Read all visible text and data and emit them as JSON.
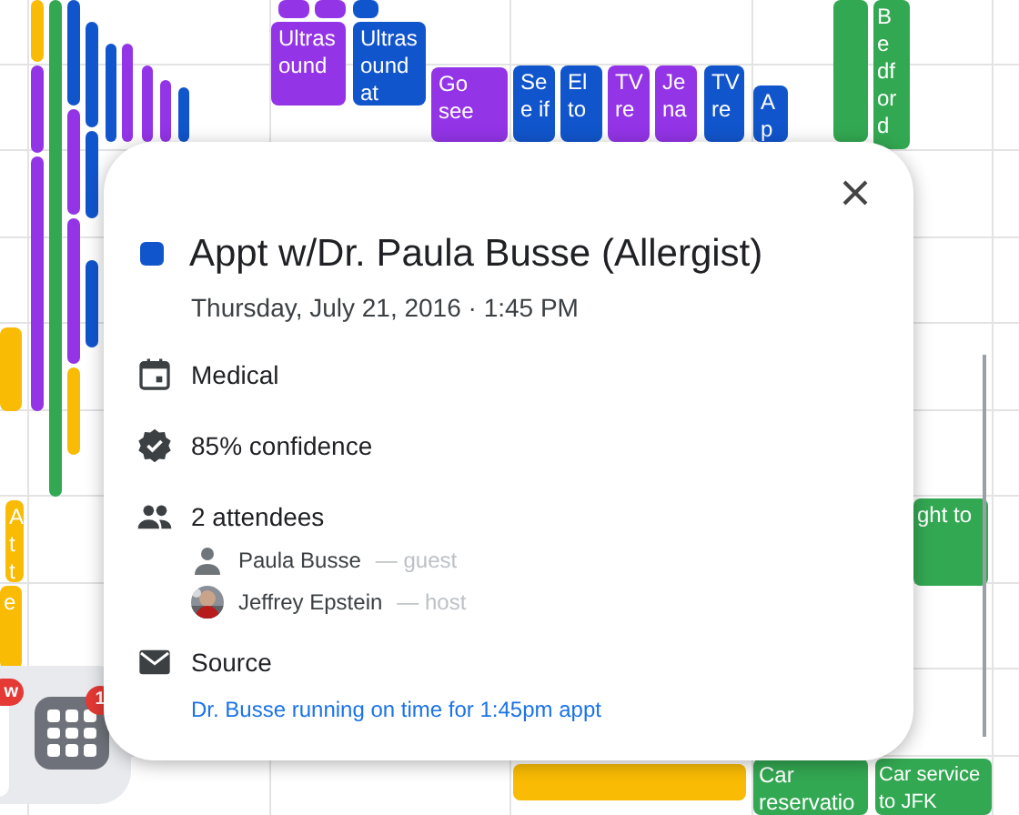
{
  "calendar": {
    "events": [
      {
        "color": "#9334e6"
      },
      {
        "color": "#9334e6"
      },
      {
        "color": "#1155cc"
      },
      {
        "text": "Ultras ound",
        "color": "#9334e6"
      },
      {
        "text": "Ultras ound at",
        "color": "#1155cc"
      },
      {
        "text": "Go see",
        "color": "#9334e6"
      },
      {
        "text": "Se e if",
        "color": "#1155cc"
      },
      {
        "text": "El to",
        "color": "#1155cc"
      },
      {
        "text": "TV re",
        "color": "#9334e6"
      },
      {
        "text": "Je na",
        "color": "#9334e6"
      },
      {
        "text": "TV re",
        "color": "#1155cc"
      },
      {
        "text": "A p",
        "color": "#1155cc"
      },
      {
        "color": "#33a852"
      },
      {
        "text": "B e df or d",
        "color": "#33a852"
      },
      {
        "text": "ght to",
        "color": "#33a852"
      },
      {
        "color": "#f9bb04"
      },
      {
        "text": "Car reservatio",
        "color": "#33a852"
      },
      {
        "text": "Car service to JFK",
        "color": "#33a852"
      },
      {
        "color": "#f9bb04"
      },
      {
        "text": "A t t",
        "color": "#f9bb04"
      },
      {
        "text": "e",
        "color": "#f9bb04"
      },
      {
        "color": "#f9bb04"
      },
      {
        "color": "#9334e6"
      },
      {
        "color": "#9334e6"
      },
      {
        "color": "#33a852"
      },
      {
        "color": "#1155cc"
      },
      {
        "color": "#9334e6"
      },
      {
        "color": "#9334e6"
      },
      {
        "color": "#f9bb04"
      },
      {
        "color": "#1155cc"
      },
      {
        "color": "#1155cc"
      },
      {
        "color": "#1155cc"
      },
      {
        "color": "#1155cc"
      },
      {
        "color": "#9334e6"
      },
      {
        "color": "#9334e6"
      },
      {
        "color": "#9334e6"
      },
      {
        "color": "#1155cc"
      }
    ]
  },
  "dock": {
    "badges": [
      "w",
      "1"
    ]
  },
  "popup": {
    "title": "Appt w/Dr. Paula Busse (Allergist)",
    "color": "#1155cc",
    "datetime": "Thursday, July 21, 2016 · 1:45 PM",
    "calendar": "Medical",
    "confidence": "85% confidence",
    "attendees_heading": "2 attendees",
    "attendees": [
      {
        "name": "Paula Busse",
        "role": "— guest",
        "kind": "silhouette"
      },
      {
        "name": "Jeffrey Epstein",
        "role": "— host"
      }
    ],
    "source_label": "Source",
    "source_link": "Dr. Busse running on time for 1:45pm appt"
  }
}
